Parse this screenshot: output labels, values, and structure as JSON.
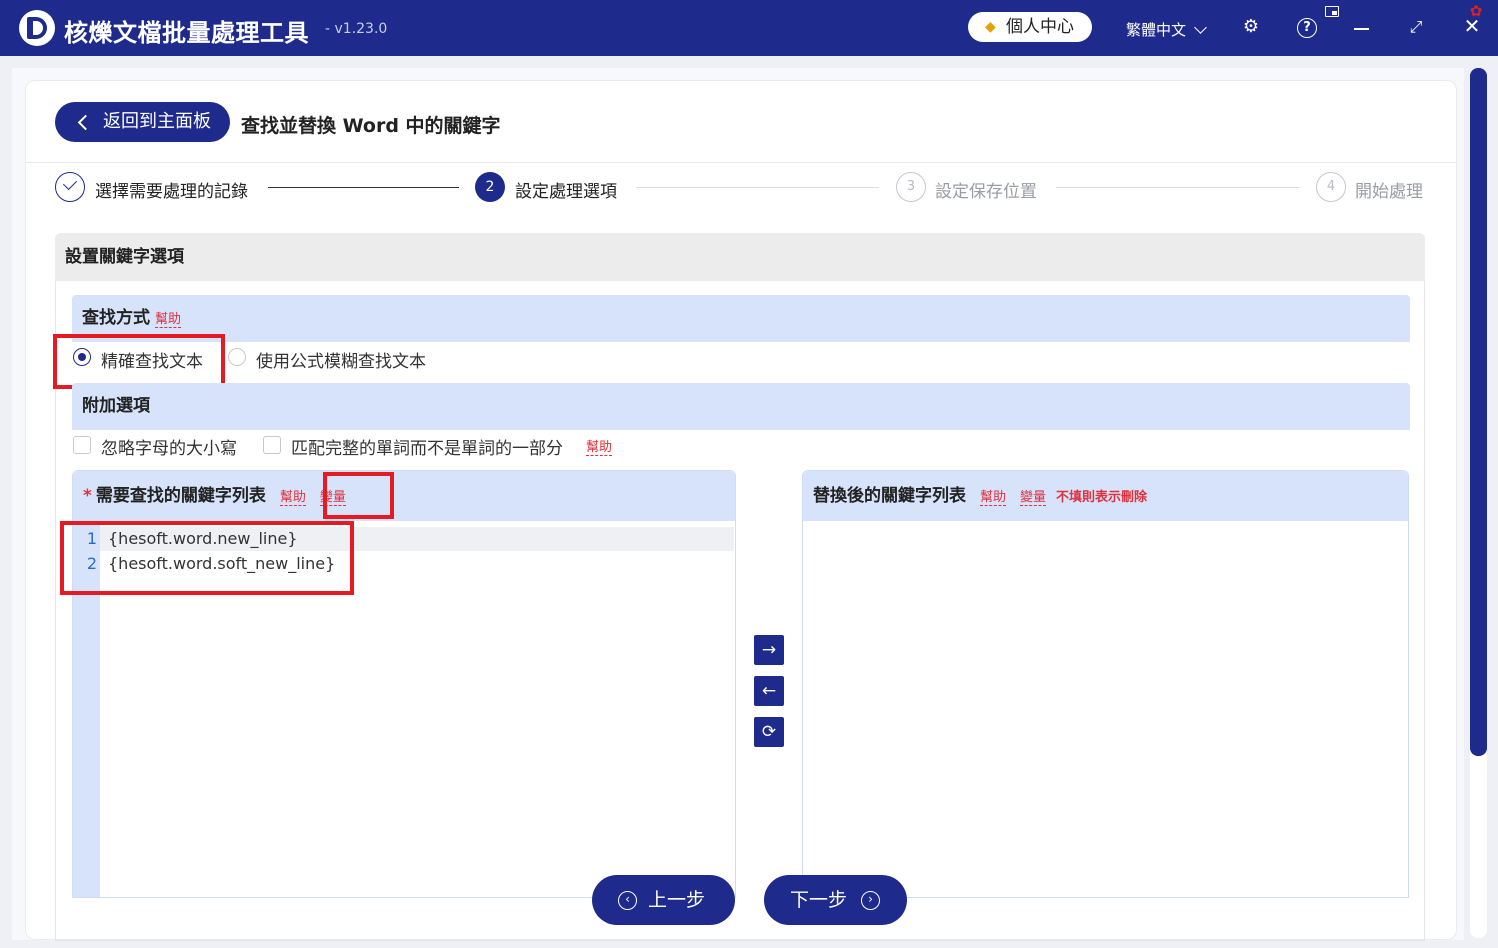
{
  "app": {
    "title": "核爍文檔批量處理工具",
    "version": "- v1.23.0",
    "user_center": "個人中心",
    "language": "繁體中文",
    "icons": [
      "gem-icon",
      "gear-icon",
      "help-icon",
      "pip-icon",
      "minimize-icon",
      "maximize-icon",
      "close-icon"
    ]
  },
  "header": {
    "back_label": "返回到主面板",
    "page_title": "查找並替換 Word 中的關鍵字"
  },
  "steps": [
    {
      "num": "1",
      "label": "選擇需要處理的記錄",
      "state": "done"
    },
    {
      "num": "2",
      "label": "設定處理選項",
      "state": "active"
    },
    {
      "num": "3",
      "label": "設定保存位置",
      "state": "todo"
    },
    {
      "num": "4",
      "label": "開始處理",
      "state": "todo"
    }
  ],
  "options": {
    "section_title": "設置關鍵字選項",
    "search_mode": {
      "title": "查找方式",
      "help": "幫助",
      "choices": [
        "精確查找文本",
        "使用公式模糊查找文本"
      ],
      "selected": "精確查找文本"
    },
    "extra": {
      "title": "附加選項",
      "ignore_case": "忽略字母的大小寫",
      "whole_word": "匹配完整的單詞而不是單詞的一部分",
      "help": "幫助"
    }
  },
  "find_panel": {
    "required_mark": "*",
    "title": "需要查找的關鍵字列表",
    "help": "幫助",
    "variables": "變量",
    "lines": [
      {
        "no": "1",
        "text": "{hesoft.word.new_line}"
      },
      {
        "no": "2",
        "text": "{hesoft.word.soft_new_line}"
      }
    ]
  },
  "replace_panel": {
    "title": "替換後的關鍵字列表",
    "help": "幫助",
    "variables": "變量",
    "note": "不填則表示刪除"
  },
  "arrows": {
    "right": "→",
    "left": "←",
    "refresh": "⟳"
  },
  "footer": {
    "prev": "上一步",
    "next": "下一步"
  },
  "colors": {
    "accent": "#1e2a8c",
    "highlight_box": "#e41b23",
    "panel_bg": "#d6e3fb"
  }
}
